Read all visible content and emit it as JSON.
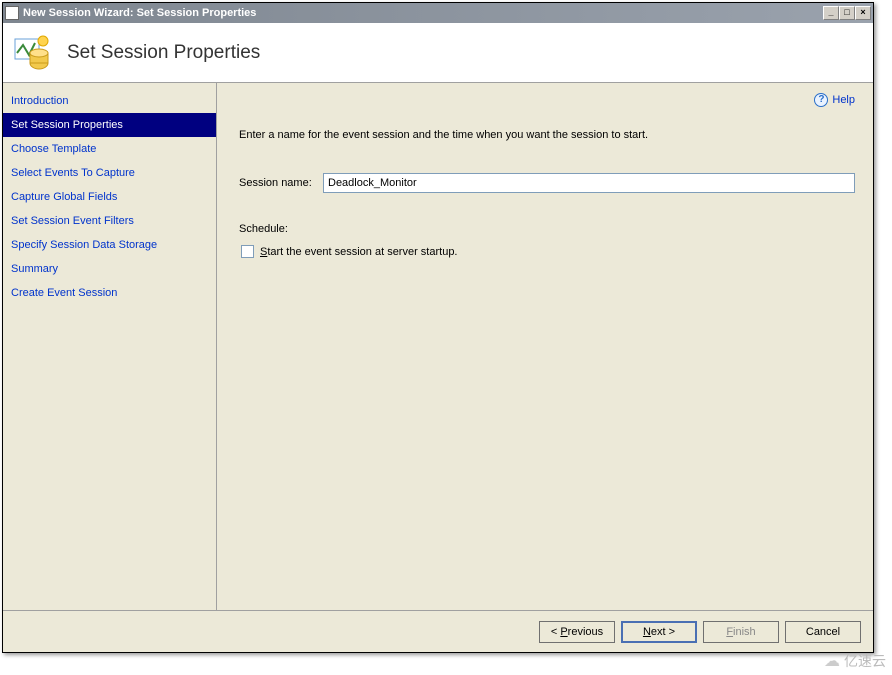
{
  "window": {
    "title": "New Session Wizard: Set Session Properties"
  },
  "header": {
    "page_title": "Set Session Properties"
  },
  "help": {
    "label": "Help"
  },
  "sidebar": {
    "items": [
      {
        "label": "Introduction"
      },
      {
        "label": "Set Session Properties"
      },
      {
        "label": "Choose Template"
      },
      {
        "label": "Select Events To Capture"
      },
      {
        "label": "Capture Global Fields"
      },
      {
        "label": "Set Session Event Filters"
      },
      {
        "label": "Specify Session Data Storage"
      },
      {
        "label": "Summary"
      },
      {
        "label": "Create Event Session"
      }
    ],
    "selected_index": 1
  },
  "main": {
    "instruction": "Enter a name for the event session and the time when you want the session to start.",
    "session_name_label": "Session name:",
    "session_name_value": "Deadlock_Monitor",
    "schedule_label": "Schedule:",
    "checkbox_label_prefix": "S",
    "checkbox_label_rest": "tart the event session at server startup.",
    "checkbox_checked": false
  },
  "footer": {
    "previous_prefix": "< ",
    "previous_u": "P",
    "previous_rest": "revious",
    "next_u": "N",
    "next_rest": "ext >",
    "finish_u": "F",
    "finish_rest": "inish",
    "cancel": "Cancel"
  },
  "watermark": {
    "text": "亿速云"
  }
}
